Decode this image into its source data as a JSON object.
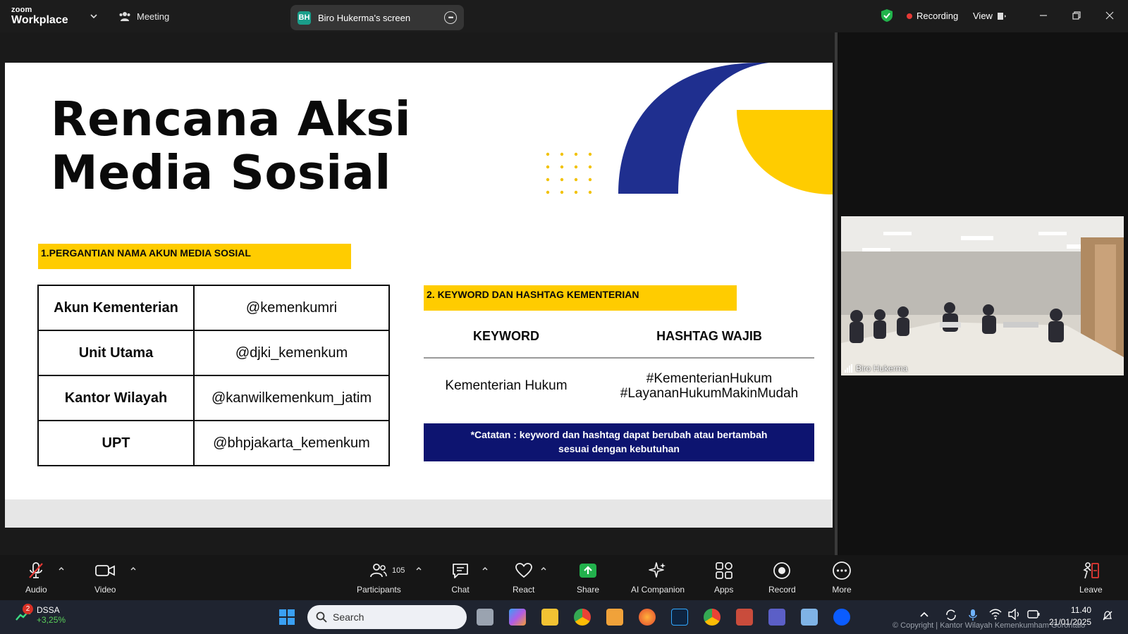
{
  "app": {
    "brand_top": "zoom",
    "brand_bottom": "Workplace",
    "meeting_label": "Meeting",
    "share_initials": "BH",
    "share_label": "Biro Hukerma's screen",
    "recording_label": "Recording",
    "view_label": "View"
  },
  "slide": {
    "title_line1": "Rencana Aksi",
    "title_line2": "Media Sosial",
    "section1_title": "1.PERGANTIAN NAMA AKUN MEDIA SOSIAL",
    "accounts": [
      {
        "label": "Akun Kementerian",
        "handle": "@kemenkumri"
      },
      {
        "label": "Unit Utama",
        "handle": "@djki_kemenkum"
      },
      {
        "label": "Kantor Wilayah",
        "handle": "@kanwilkemenkum_jatim"
      },
      {
        "label": "UPT",
        "handle": "@bhpjakarta_kemenkum"
      }
    ],
    "section2_title": "2. KEYWORD DAN HASHTAG KEMENTERIAN",
    "col_keyword": "KEYWORD",
    "col_hashtag": "HASHTAG WAJIB",
    "keyword": "Kementerian Hukum",
    "hashtag1": "#KementerianHukum",
    "hashtag2": "#LayananHukumMakinMudah",
    "note_line1": "*Catatan : keyword dan hashtag dapat berubah atau bertambah",
    "note_line2": "sesuai dengan kebutuhan",
    "colors": {
      "yellow": "#ffcc00",
      "navy": "#1f2f8f",
      "note_bg": "#0d1470"
    }
  },
  "participant": {
    "name": "Biro Hukerma"
  },
  "toolbar": {
    "audio": "Audio",
    "video": "Video",
    "participants": "Participants",
    "participants_count": "105",
    "chat": "Chat",
    "react": "React",
    "share": "Share",
    "ai_companion": "AI Companion",
    "apps": "Apps",
    "record": "Record",
    "more": "More",
    "leave": "Leave"
  },
  "taskbar": {
    "stock_badge": "2",
    "stock_name": "DSSA",
    "stock_change": "+3,25%",
    "search_placeholder": "Search",
    "time": "11.40",
    "date": "21/01/2025",
    "copyright": "© Copyright | Kantor Wilayah Kemenkumham Gorontalo"
  }
}
